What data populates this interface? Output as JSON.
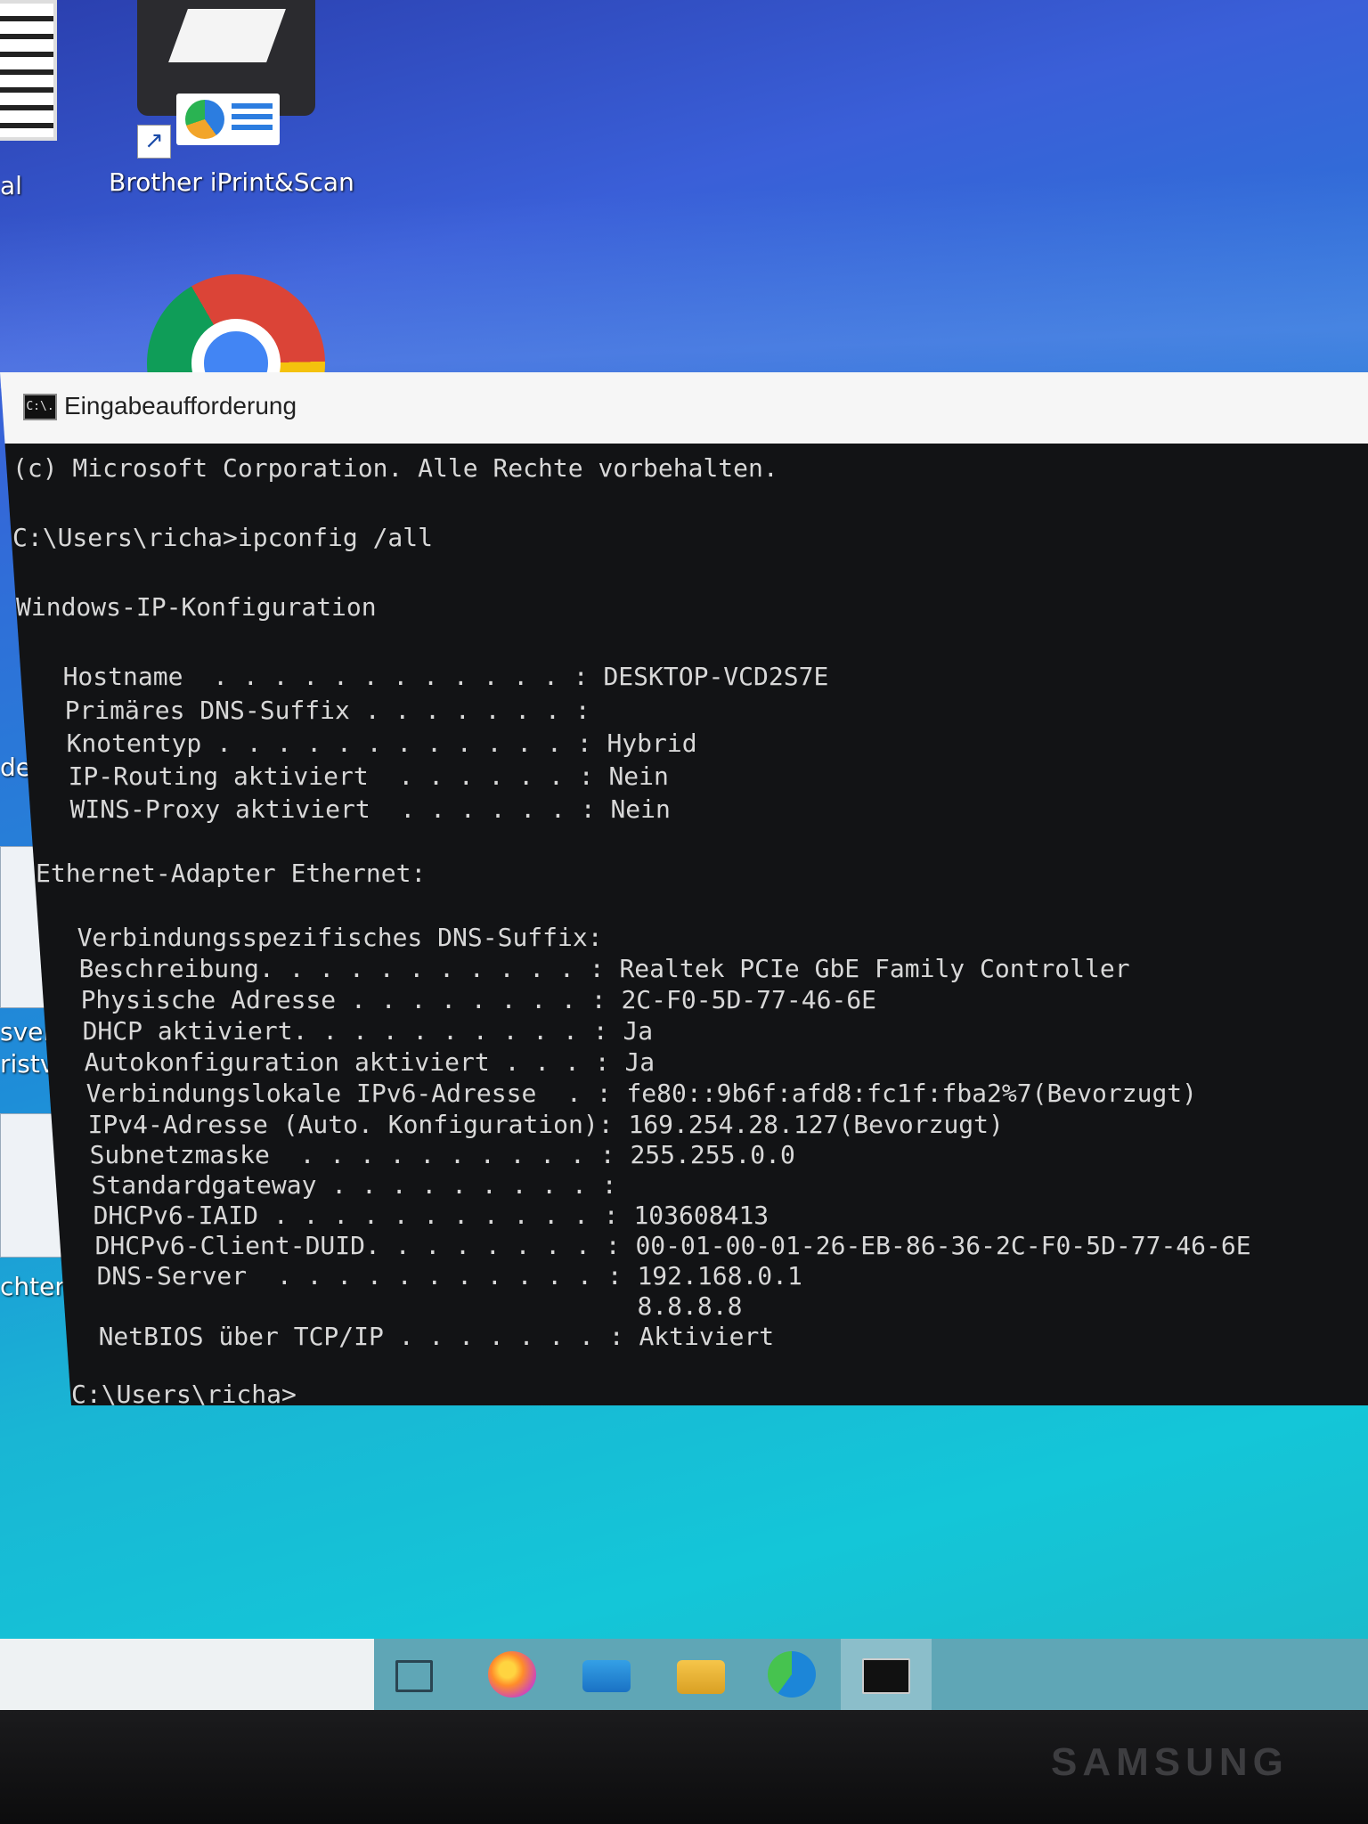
{
  "desktop": {
    "icons": [
      {
        "label": "Brother iPrint&Scan"
      }
    ],
    "left_fragments": [
      "al",
      "der",
      "sverf",
      "ristve",
      "chten L"
    ]
  },
  "window": {
    "title": "Eingabeaufforderung",
    "icon_glyph": "C:\\."
  },
  "console": {
    "lines": [
      "(c) Microsoft Corporation. Alle Rechte vorbehalten.",
      "",
      "C:\\Users\\richa>ipconfig /all",
      "",
      "Windows-IP-Konfiguration",
      "",
      "   Hostname  . . . . . . . . . . . . : DESKTOP-VCD2S7E",
      "   Primäres DNS-Suffix . . . . . . . :",
      "   Knotentyp . . . . . . . . . . . . : Hybrid",
      "   IP-Routing aktiviert  . . . . . . : Nein",
      "   WINS-Proxy aktiviert  . . . . . . : Nein",
      "",
      "Ethernet-Adapter Ethernet:",
      "",
      "   Verbindungsspezifisches DNS-Suffix:",
      "   Beschreibung. . . . . . . . . . . : Realtek PCIe GbE Family Controller",
      "   Physische Adresse . . . . . . . . : 2C-F0-5D-77-46-6E",
      "   DHCP aktiviert. . . . . . . . . . : Ja",
      "   Autokonfiguration aktiviert . . . : Ja",
      "   Verbindungslokale IPv6-Adresse  . : fe80::9b6f:afd8:fc1f:fba2%7(Bevorzugt)",
      "   IPv4-Adresse (Auto. Konfiguration): 169.254.28.127(Bevorzugt)",
      "   Subnetzmaske  . . . . . . . . . . : 255.255.0.0",
      "   Standardgateway . . . . . . . . . :",
      "   DHCPv6-IAID . . . . . . . . . . . : 103608413",
      "   DHCPv6-Client-DUID. . . . . . . . : 00-01-00-01-26-EB-86-36-2C-F0-5D-77-46-6E",
      "   DNS-Server  . . . . . . . . . . . : 192.168.0.1",
      "                                       8.8.8.8",
      "   NetBIOS über TCP/IP . . . . . . . : Aktiviert",
      "",
      "C:\\Users\\richa>"
    ]
  },
  "taskbar": {
    "items": [
      "task-view",
      "firefox",
      "mail",
      "file-explorer",
      "edge",
      "command-prompt"
    ]
  },
  "monitor": {
    "brand": "SAMSUNG"
  }
}
